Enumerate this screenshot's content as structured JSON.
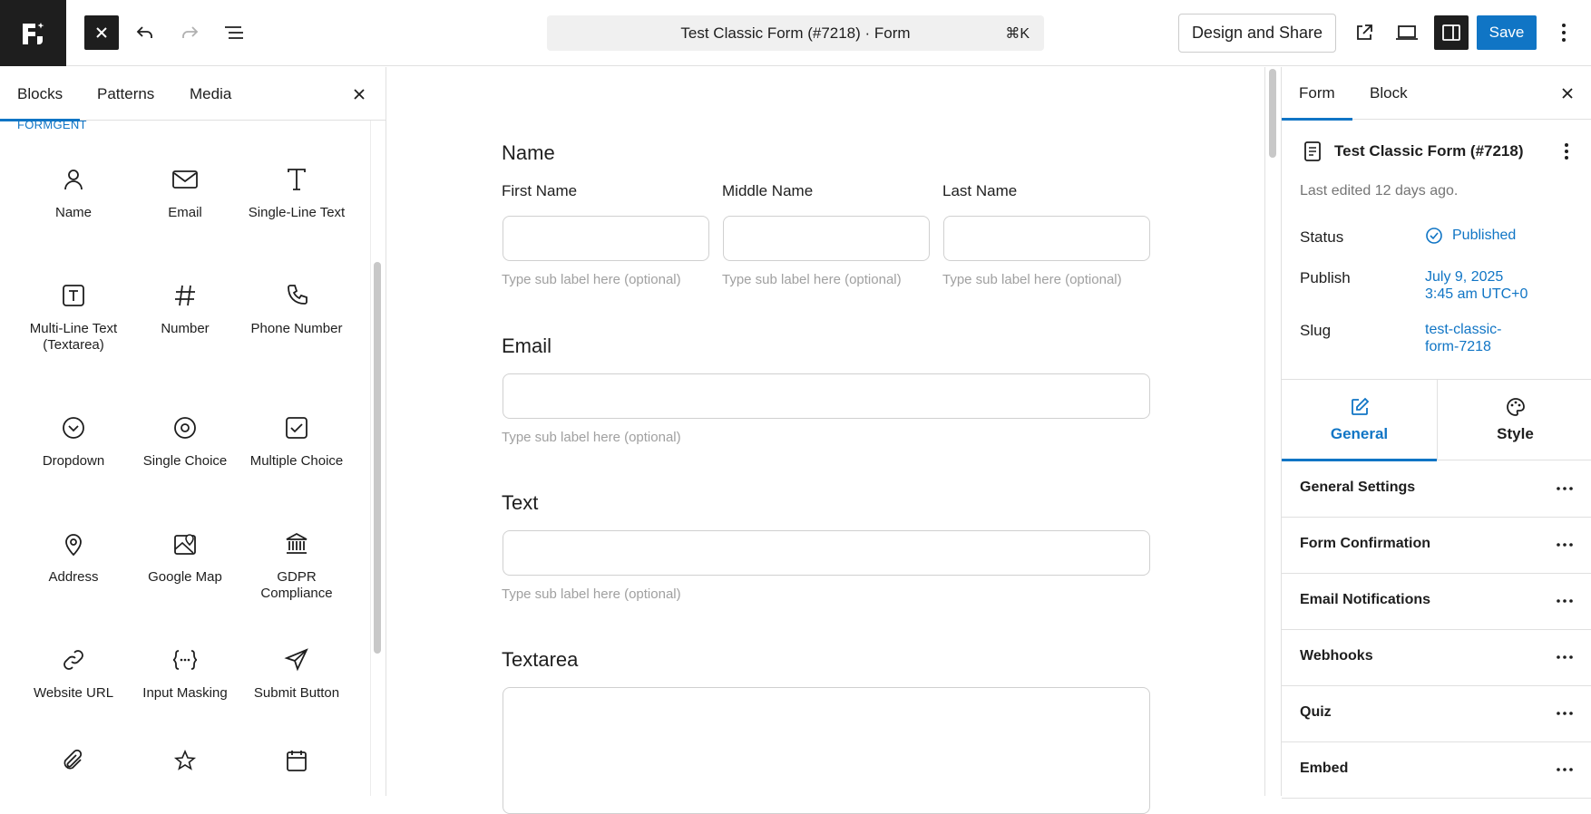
{
  "header": {
    "document_title": "Test Classic Form (#7218) · Form",
    "shortcut": "⌘K",
    "design_share_label": "Design and Share",
    "save_label": "Save"
  },
  "left_panel": {
    "tabs": [
      "Blocks",
      "Patterns",
      "Media"
    ],
    "category": "FORMGENT",
    "blocks": [
      {
        "label": "Name",
        "icon": "person-icon"
      },
      {
        "label": "Email",
        "icon": "envelope-icon"
      },
      {
        "label": "Single-Line Text",
        "icon": "text-icon"
      },
      {
        "label": "Multi-Line Text (Textarea)",
        "icon": "textarea-icon"
      },
      {
        "label": "Number",
        "icon": "hash-icon"
      },
      {
        "label": "Phone Number",
        "icon": "phone-icon"
      },
      {
        "label": "Dropdown",
        "icon": "chevron-circle-icon"
      },
      {
        "label": "Single Choice",
        "icon": "radio-icon"
      },
      {
        "label": "Multiple Choice",
        "icon": "checkbox-icon"
      },
      {
        "label": "Address",
        "icon": "map-pin-icon"
      },
      {
        "label": "Google Map",
        "icon": "map-icon"
      },
      {
        "label": "GDPR Compliance",
        "icon": "bank-icon"
      },
      {
        "label": "Website URL",
        "icon": "link-icon"
      },
      {
        "label": "Input Masking",
        "icon": "braces-icon"
      },
      {
        "label": "Submit Button",
        "icon": "send-icon"
      },
      {
        "label": "",
        "icon": "paperclip-icon"
      },
      {
        "label": "",
        "icon": "star-icon"
      },
      {
        "label": "",
        "icon": "calendar-icon"
      }
    ]
  },
  "form": {
    "name_title": "Name",
    "first_name_label": "First Name",
    "middle_name_label": "Middle Name",
    "last_name_label": "Last Name",
    "sub_label_placeholder": "Type sub label here (optional)",
    "email_title": "Email",
    "text_title": "Text",
    "textarea_title": "Textarea"
  },
  "right_panel": {
    "tabs": [
      "Form",
      "Block"
    ],
    "document_name": "Test Classic Form (#7218)",
    "last_edited": "Last edited 12 days ago.",
    "status_label": "Status",
    "status_value": "Published",
    "publish_label": "Publish",
    "publish_date": "July 9, 2025",
    "publish_time": "3:45 am UTC+0",
    "slug_label": "Slug",
    "slug_line1": "test-classic-",
    "slug_line2": "form-7218",
    "setting_tabs": [
      "General",
      "Style"
    ],
    "sections": [
      "General Settings",
      "Form Confirmation",
      "Email Notifications",
      "Webhooks",
      "Quiz",
      "Embed"
    ]
  },
  "colors": {
    "accent": "#1075c5",
    "dark": "#1e1e1e",
    "muted": "#757575"
  }
}
